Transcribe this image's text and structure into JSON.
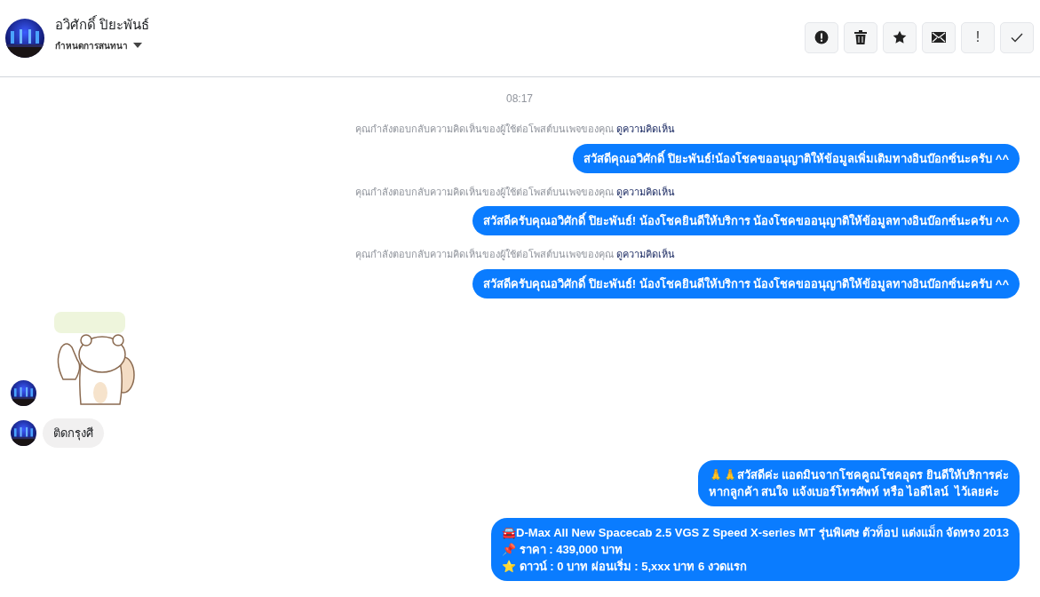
{
  "header": {
    "name": "อวิศักดิ์ ปิยะพันธ์",
    "subtitle": "กำหนดการสนทนา",
    "actions": [
      {
        "kind": "alert"
      },
      {
        "kind": "trash"
      },
      {
        "kind": "star"
      },
      {
        "kind": "mail"
      },
      {
        "kind": "exclaim",
        "text": "!"
      },
      {
        "kind": "check"
      }
    ]
  },
  "messages": [
    {
      "kind": "time",
      "text": "08:17"
    },
    {
      "kind": "notice",
      "text": "คุณกำลังตอบกลับความคิดเห็นของผู้ใช้ต่อโพสต์บนเพจของคุณ",
      "link": "ดูความคิดเห็น"
    },
    {
      "kind": "outgoing",
      "lines": [
        "สวัสดีคุณอวิศักดิ์ ปิยะพันธ์!น้องโชคขออนุญาติให้ข้อมูลเพิ่มเติมทางอินบ๊อกซ์นะครับ ^^"
      ]
    },
    {
      "kind": "notice",
      "text": "คุณกำลังตอบกลับความคิดเห็นของผู้ใช้ต่อโพสต์บนเพจของคุณ",
      "link": "ดูความคิดเห็น"
    },
    {
      "kind": "outgoing",
      "lines": [
        "สวัสดีครับคุณอวิศักดิ์ ปิยะพันธ์! น้องโชคยินดีให้บริการ น้องโชคขออนุญาติให้ข้อมูลทางอินบ๊อกซ์นะครับ ^^"
      ]
    },
    {
      "kind": "notice",
      "text": "คุณกำลังตอบกลับความคิดเห็นของผู้ใช้ต่อโพสต์บนเพจของคุณ",
      "link": "ดูความคิดเห็น"
    },
    {
      "kind": "outgoing",
      "lines": [
        "สวัสดีครับคุณอวิศักดิ์ ปิยะพันธ์! น้องโชคยินดีให้บริการ น้องโชคขออนุญาติให้ข้อมูลทางอินบ๊อกซ์นะครับ ^^"
      ]
    },
    {
      "kind": "sticker"
    },
    {
      "kind": "incoming",
      "lines": [
        "ติดกรุงศี"
      ]
    },
    {
      "kind": "outgoing",
      "lines": [
        "🙏🙏สวัสดีค่ะ แอดมินจากโชคคูณโชคอุดร ยินดีให้บริการค่ะ",
        "หากลูกค้า สนใจ แจ้งเบอร์โทรศัพท์ หรือ ไอดีไลน์  ไว้เลยค่ะ"
      ]
    },
    {
      "kind": "outgoing",
      "lines": [
        "🚘D-Max All New Spacecab 2.5 VGS Z Speed X-series MT รุ่นพิเศษ ตัวท็อป แต่งแม็ก จัดทรง 2013",
        "📌 ราคา : 439,000 บาท",
        "⭐ ดาวน์ : 0 บาท ผ่อนเริ่ม : 5,xxx บาท 6 งวดแรก"
      ]
    }
  ]
}
